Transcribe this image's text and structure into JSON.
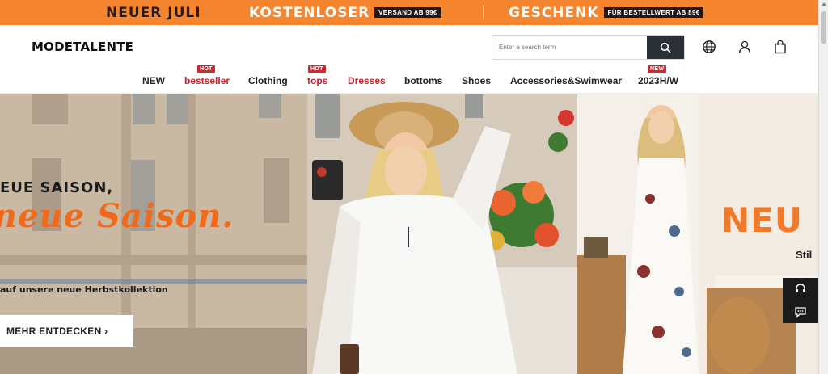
{
  "promo": {
    "seg1": "NEUER JULI",
    "seg2": "KOSTENLOSER",
    "seg2_pill": "VERSAND AB 99€",
    "seg3": "GESCHENK",
    "seg3_pill": "FÜR BESTELLWERT AB 89€",
    "accent": "#f5862f"
  },
  "header": {
    "logo": "MODETALENTE",
    "search_placeholder": "Enter a search term",
    "icons": [
      "globe-icon",
      "user-icon",
      "shopping-bag-icon",
      "search-icon"
    ]
  },
  "nav": {
    "items": [
      {
        "label": "NEW",
        "badge": ""
      },
      {
        "label": "bestseller",
        "badge": "HOT"
      },
      {
        "label": "Clothing",
        "badge": ""
      },
      {
        "label": "tops",
        "badge": "HOT"
      },
      {
        "label": "Dresses",
        "badge": ""
      },
      {
        "label": "bottoms",
        "badge": ""
      },
      {
        "label": "Shoes",
        "badge": ""
      },
      {
        "label": "Accessories&Swimwear",
        "badge": ""
      },
      {
        "label": "2023H/W",
        "badge": "NEW"
      }
    ]
  },
  "hero": {
    "title": "EUE SAISON,",
    "script": "neue Saison.",
    "subtitle": "auf unsere neue Herbstkollektion",
    "cta": "MEHR ENTDECKEN ›",
    "side_title": "NEU",
    "side_sub": "Stil"
  },
  "colors": {
    "hot_badge": "#d3272e",
    "script_orange": "#ef6a1b"
  }
}
